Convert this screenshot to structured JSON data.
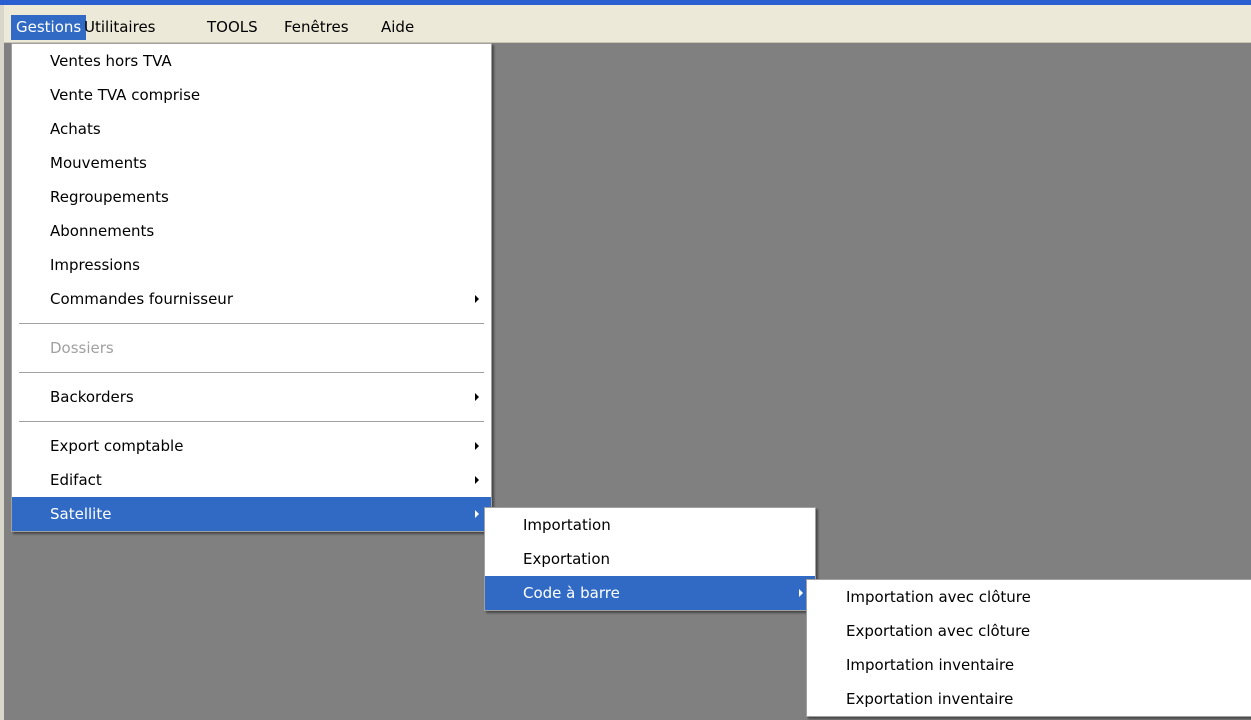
{
  "menubar": {
    "items": [
      "Gestions",
      "Utilitaires",
      "TOOLS",
      "Fenêtres",
      "Aide"
    ]
  },
  "menus": {
    "gestions": {
      "items": [
        "Ventes hors TVA",
        "Vente TVA comprise",
        "Achats",
        "Mouvements",
        "Regroupements",
        "Abonnements",
        "Impressions",
        "Commandes fournisseur",
        "Dossiers",
        "Backorders",
        "Export comptable",
        "Edifact",
        "Satellite"
      ]
    },
    "satellite": {
      "items": [
        "Importation",
        "Exportation",
        "Code à barre"
      ]
    },
    "code_barre": {
      "items": [
        "Importation avec clôture",
        "Exportation avec clôture",
        "Importation inventaire",
        "Exportation inventaire"
      ]
    }
  },
  "colors": {
    "background": "#808080",
    "menubar": "#ece9d8",
    "highlight": "#316ac5",
    "title_strip": "#2a5fd0",
    "disabled_text": "#a0a0a0"
  }
}
